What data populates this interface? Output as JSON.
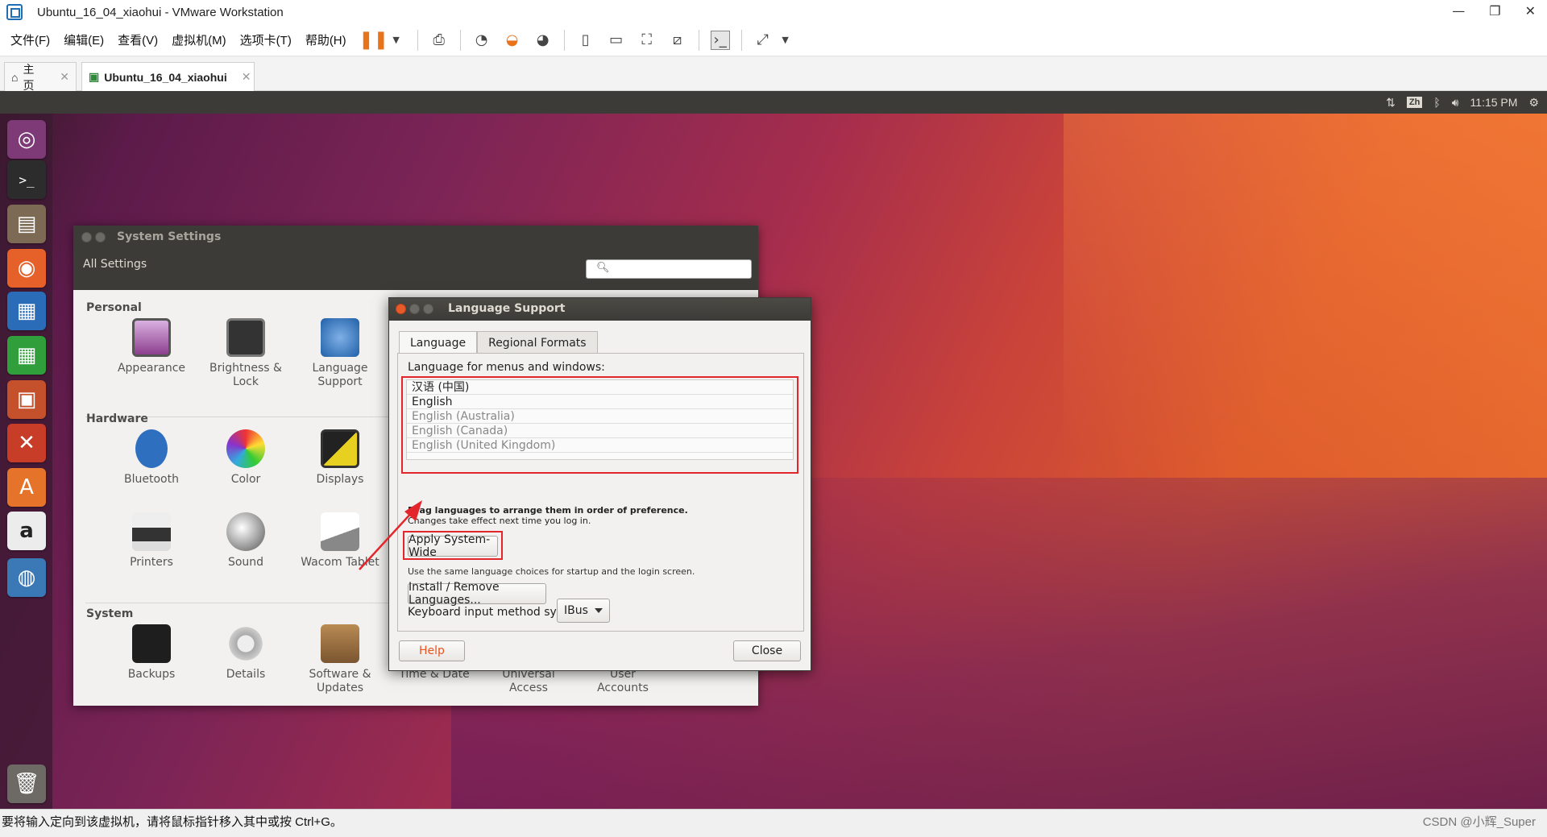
{
  "vmware": {
    "title": "Ubuntu_16_04_xiaohui - VMware Workstation",
    "menu": [
      "文件(F)",
      "编辑(E)",
      "查看(V)",
      "虚拟机(M)",
      "选项卡(T)",
      "帮助(H)"
    ],
    "tabs": [
      {
        "label": "主页"
      },
      {
        "label": "Ubuntu_16_04_xiaohui"
      }
    ],
    "status_text": "要将输入定向到该虚拟机，请将鼠标指针移入其中或按 Ctrl+G。",
    "watermark": "CSDN @小辉_Super"
  },
  "ubuntu_panel": {
    "input_badge": "Zh",
    "time": "11:15 PM"
  },
  "system_settings": {
    "title": "System Settings",
    "all_settings": "All Settings",
    "sections": {
      "personal": "Personal",
      "hardware": "Hardware",
      "system": "System"
    },
    "personal_items": [
      {
        "line1": "Appearance",
        "line2": ""
      },
      {
        "line1": "Brightness &",
        "line2": "Lock"
      },
      {
        "line1": "Language",
        "line2": "Support"
      }
    ],
    "hardware_items": [
      {
        "line1": "Bluetooth"
      },
      {
        "line1": "Color"
      },
      {
        "line1": "Displays"
      },
      {
        "line1": "Printers"
      },
      {
        "line1": "Sound"
      },
      {
        "line1": "Wacom Tablet"
      }
    ],
    "system_items": [
      {
        "line1": "Backups",
        "line2": ""
      },
      {
        "line1": "Details",
        "line2": ""
      },
      {
        "line1": "Software &",
        "line2": "Updates"
      },
      {
        "line1": "Time & Date",
        "line2": ""
      },
      {
        "line1": "Universal",
        "line2": "Access"
      },
      {
        "line1": "User",
        "line2": "Accounts"
      }
    ]
  },
  "language_support": {
    "title": "Language Support",
    "tabs": [
      "Language",
      "Regional Formats"
    ],
    "menu_label": "Language for menus and windows:",
    "languages": [
      "汉语 (中国)",
      "English",
      "English (Australia)",
      "English (Canada)",
      "English (United Kingdom)"
    ],
    "drag_hint_bold": "Drag languages to arrange them in order of preference.",
    "drag_hint": "Changes take effect next time you log in.",
    "apply_button": "Apply System-Wide",
    "apply_note": "Use the same language choices for startup and the login screen.",
    "install_button": "Install / Remove Languages...",
    "keyboard_label": "Keyboard input method system:",
    "keyboard_value": "IBus",
    "help_button": "Help",
    "close_button": "Close"
  },
  "colors": {
    "annotation_red": "#e2262b",
    "ubuntu_orange": "#e95420",
    "panel_dark": "#3c3b37"
  }
}
